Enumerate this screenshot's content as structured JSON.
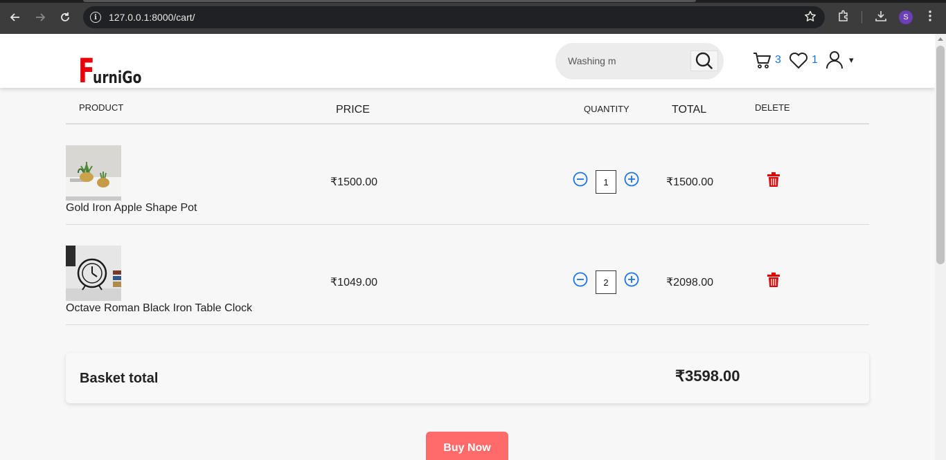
{
  "browser": {
    "url": "127.0.0.1:8000/cart/",
    "profile_initial": "S"
  },
  "header": {
    "logo_first": "F",
    "logo_rest": "urniGo",
    "search_value": "Washing m",
    "cart_count": "3",
    "wishlist_count": "1",
    "caret": "▾"
  },
  "table": {
    "headers": {
      "product": "PRODUCT",
      "price": "PRICE",
      "quantity": "QUANTITY",
      "total": "TOTAL",
      "delete": "DELETE"
    },
    "rows": [
      {
        "name": "Gold Iron Apple Shape Pot",
        "price": "₹1500.00",
        "quantity": "1",
        "total": "₹1500.00"
      },
      {
        "name": "Octave Roman Black Iron Table Clock",
        "price": "₹1049.00",
        "quantity": "2",
        "total": "₹2098.00"
      }
    ]
  },
  "basket": {
    "label": "Basket total",
    "value": "₹3598.00"
  },
  "buy_button": "Buy Now",
  "colors": {
    "brand_red": "#e8000b",
    "link_blue": "#1a73e8",
    "delete_red": "#e00000",
    "buy_button": "#ff6b6b"
  }
}
